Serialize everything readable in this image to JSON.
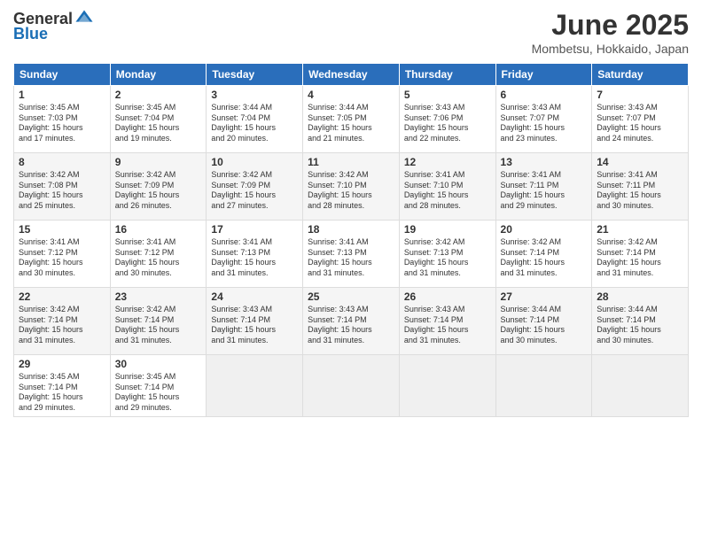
{
  "logo": {
    "general": "General",
    "blue": "Blue"
  },
  "title": {
    "month": "June 2025",
    "location": "Mombetsu, Hokkaido, Japan"
  },
  "headers": [
    "Sunday",
    "Monday",
    "Tuesday",
    "Wednesday",
    "Thursday",
    "Friday",
    "Saturday"
  ],
  "weeks": [
    [
      {
        "day": "1",
        "info": "Sunrise: 3:45 AM\nSunset: 7:03 PM\nDaylight: 15 hours\nand 17 minutes."
      },
      {
        "day": "2",
        "info": "Sunrise: 3:45 AM\nSunset: 7:04 PM\nDaylight: 15 hours\nand 19 minutes."
      },
      {
        "day": "3",
        "info": "Sunrise: 3:44 AM\nSunset: 7:04 PM\nDaylight: 15 hours\nand 20 minutes."
      },
      {
        "day": "4",
        "info": "Sunrise: 3:44 AM\nSunset: 7:05 PM\nDaylight: 15 hours\nand 21 minutes."
      },
      {
        "day": "5",
        "info": "Sunrise: 3:43 AM\nSunset: 7:06 PM\nDaylight: 15 hours\nand 22 minutes."
      },
      {
        "day": "6",
        "info": "Sunrise: 3:43 AM\nSunset: 7:07 PM\nDaylight: 15 hours\nand 23 minutes."
      },
      {
        "day": "7",
        "info": "Sunrise: 3:43 AM\nSunset: 7:07 PM\nDaylight: 15 hours\nand 24 minutes."
      }
    ],
    [
      {
        "day": "8",
        "info": "Sunrise: 3:42 AM\nSunset: 7:08 PM\nDaylight: 15 hours\nand 25 minutes."
      },
      {
        "day": "9",
        "info": "Sunrise: 3:42 AM\nSunset: 7:09 PM\nDaylight: 15 hours\nand 26 minutes."
      },
      {
        "day": "10",
        "info": "Sunrise: 3:42 AM\nSunset: 7:09 PM\nDaylight: 15 hours\nand 27 minutes."
      },
      {
        "day": "11",
        "info": "Sunrise: 3:42 AM\nSunset: 7:10 PM\nDaylight: 15 hours\nand 28 minutes."
      },
      {
        "day": "12",
        "info": "Sunrise: 3:41 AM\nSunset: 7:10 PM\nDaylight: 15 hours\nand 28 minutes."
      },
      {
        "day": "13",
        "info": "Sunrise: 3:41 AM\nSunset: 7:11 PM\nDaylight: 15 hours\nand 29 minutes."
      },
      {
        "day": "14",
        "info": "Sunrise: 3:41 AM\nSunset: 7:11 PM\nDaylight: 15 hours\nand 30 minutes."
      }
    ],
    [
      {
        "day": "15",
        "info": "Sunrise: 3:41 AM\nSunset: 7:12 PM\nDaylight: 15 hours\nand 30 minutes."
      },
      {
        "day": "16",
        "info": "Sunrise: 3:41 AM\nSunset: 7:12 PM\nDaylight: 15 hours\nand 30 minutes."
      },
      {
        "day": "17",
        "info": "Sunrise: 3:41 AM\nSunset: 7:13 PM\nDaylight: 15 hours\nand 31 minutes."
      },
      {
        "day": "18",
        "info": "Sunrise: 3:41 AM\nSunset: 7:13 PM\nDaylight: 15 hours\nand 31 minutes."
      },
      {
        "day": "19",
        "info": "Sunrise: 3:42 AM\nSunset: 7:13 PM\nDaylight: 15 hours\nand 31 minutes."
      },
      {
        "day": "20",
        "info": "Sunrise: 3:42 AM\nSunset: 7:14 PM\nDaylight: 15 hours\nand 31 minutes."
      },
      {
        "day": "21",
        "info": "Sunrise: 3:42 AM\nSunset: 7:14 PM\nDaylight: 15 hours\nand 31 minutes."
      }
    ],
    [
      {
        "day": "22",
        "info": "Sunrise: 3:42 AM\nSunset: 7:14 PM\nDaylight: 15 hours\nand 31 minutes."
      },
      {
        "day": "23",
        "info": "Sunrise: 3:42 AM\nSunset: 7:14 PM\nDaylight: 15 hours\nand 31 minutes."
      },
      {
        "day": "24",
        "info": "Sunrise: 3:43 AM\nSunset: 7:14 PM\nDaylight: 15 hours\nand 31 minutes."
      },
      {
        "day": "25",
        "info": "Sunrise: 3:43 AM\nSunset: 7:14 PM\nDaylight: 15 hours\nand 31 minutes."
      },
      {
        "day": "26",
        "info": "Sunrise: 3:43 AM\nSunset: 7:14 PM\nDaylight: 15 hours\nand 31 minutes."
      },
      {
        "day": "27",
        "info": "Sunrise: 3:44 AM\nSunset: 7:14 PM\nDaylight: 15 hours\nand 30 minutes."
      },
      {
        "day": "28",
        "info": "Sunrise: 3:44 AM\nSunset: 7:14 PM\nDaylight: 15 hours\nand 30 minutes."
      }
    ],
    [
      {
        "day": "29",
        "info": "Sunrise: 3:45 AM\nSunset: 7:14 PM\nDaylight: 15 hours\nand 29 minutes."
      },
      {
        "day": "30",
        "info": "Sunrise: 3:45 AM\nSunset: 7:14 PM\nDaylight: 15 hours\nand 29 minutes."
      },
      {
        "day": "",
        "info": ""
      },
      {
        "day": "",
        "info": ""
      },
      {
        "day": "",
        "info": ""
      },
      {
        "day": "",
        "info": ""
      },
      {
        "day": "",
        "info": ""
      }
    ]
  ]
}
